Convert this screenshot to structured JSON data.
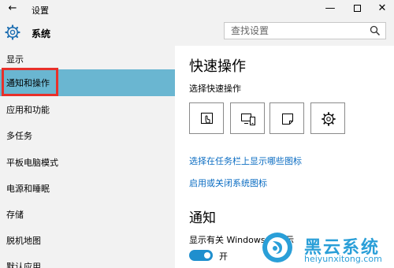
{
  "window": {
    "title": "设置",
    "back_glyph": "←",
    "minimize_glyph": "—",
    "close_glyph": "✕"
  },
  "header": {
    "title": "系统",
    "search_placeholder": "查找设置"
  },
  "sidebar": {
    "items": [
      {
        "label": "显示"
      },
      {
        "label": "通知和操作"
      },
      {
        "label": "应用和功能"
      },
      {
        "label": "多任务"
      },
      {
        "label": "平板电脑模式"
      },
      {
        "label": "电源和睡眠"
      },
      {
        "label": "存储"
      },
      {
        "label": "脱机地图"
      },
      {
        "label": "默认应用"
      }
    ],
    "active_index": 1
  },
  "main": {
    "quick_actions_heading": "快速操作",
    "quick_actions_sub": "选择快速操作",
    "quick_actions": [
      {
        "icon": "tablet-mode-icon"
      },
      {
        "icon": "connect-icon"
      },
      {
        "icon": "note-icon"
      },
      {
        "icon": "settings-icon"
      }
    ],
    "link_taskbar_icons": "选择在任务栏上显示哪些图标",
    "link_system_icons": "启用或关闭系统图标",
    "notifications_heading": "通知",
    "windows_tips_label": "显示有关 Windows 的提示",
    "windows_tips_state": "开"
  },
  "watermark": {
    "brand": "黑云系统",
    "url": "heiyunxitong.com"
  },
  "colors": {
    "sidebar_bg": "#f2f2f2",
    "active_item": "#6ab6d1",
    "highlight_border": "#e8302a",
    "link": "#0a6cc2",
    "toggle_on": "#1f8fce",
    "watermark": "#2a9fd8"
  }
}
